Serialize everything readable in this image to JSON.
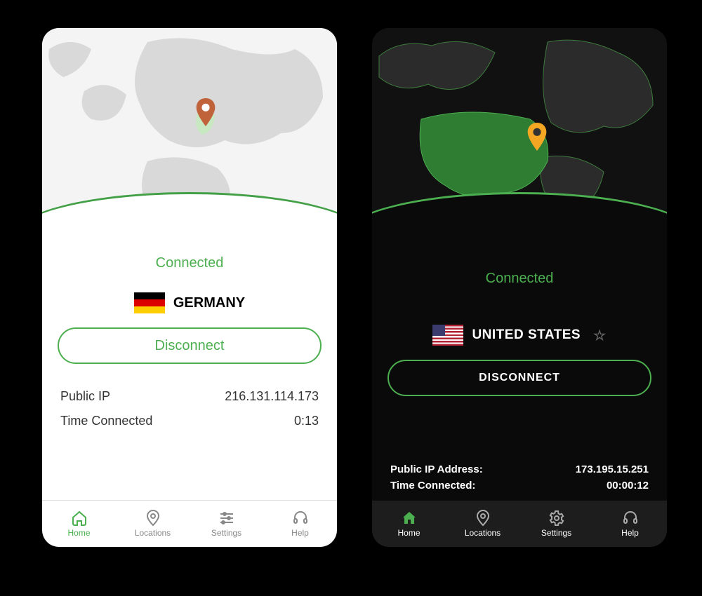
{
  "left": {
    "status": "Connected",
    "country": "GERMANY",
    "flag": "flag-de",
    "disconnect": "Disconnect",
    "stats": {
      "publicIpLabel": "Public IP",
      "publicIpValue": "216.131.114.173",
      "timeLabel": "Time Connected",
      "timeValue": "0:13"
    },
    "nav": {
      "home": "Home",
      "locations": "Locations",
      "settings": "Settings",
      "help": "Help"
    }
  },
  "right": {
    "status": "Connected",
    "country": "UNITED STATES",
    "flag": "flag-us",
    "disconnect": "DISCONNECT",
    "stats": {
      "publicIpLabel": "Public IP Address:",
      "publicIpValue": "173.195.15.251",
      "timeLabel": "Time Connected:",
      "timeValue": "00:00:12"
    },
    "nav": {
      "home": "Home",
      "locations": "Locations",
      "settings": "Settings",
      "help": "Help"
    }
  },
  "colors": {
    "accent": "#4caf50",
    "pinLeft": "#c1633a",
    "pinRight": "#f5a623"
  }
}
